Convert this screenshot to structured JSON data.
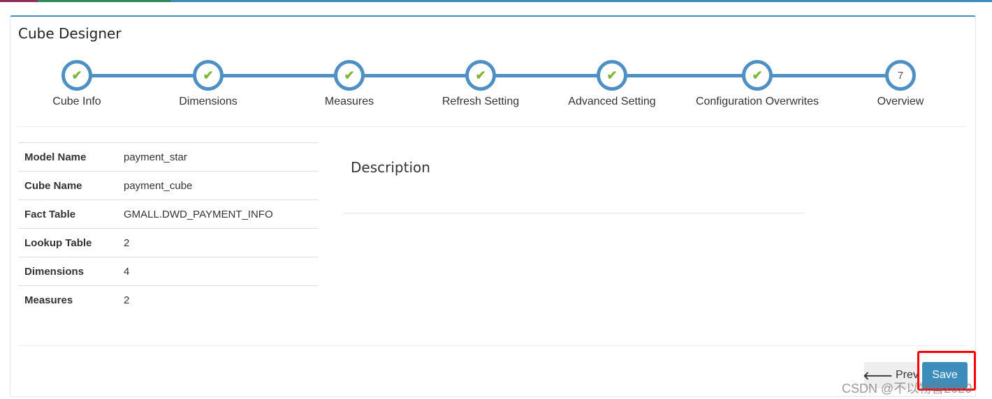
{
  "title": "Cube Designer",
  "steps": [
    {
      "label": "Cube Info",
      "state": "done"
    },
    {
      "label": "Dimensions",
      "state": "done"
    },
    {
      "label": "Measures",
      "state": "done"
    },
    {
      "label": "Refresh Setting",
      "state": "done"
    },
    {
      "label": "Advanced Setting",
      "state": "done"
    },
    {
      "label": "Configuration Overwrites",
      "state": "done"
    },
    {
      "label": "Overview",
      "state": "current",
      "number": "7"
    }
  ],
  "check_icon": "✔",
  "summary": [
    {
      "key": "Model Name",
      "value": "payment_star"
    },
    {
      "key": "Cube Name",
      "value": "payment_cube"
    },
    {
      "key": "Fact Table",
      "value": "GMALL.DWD_PAYMENT_INFO"
    },
    {
      "key": "Lookup Table",
      "value": "2"
    },
    {
      "key": "Dimensions",
      "value": "4"
    },
    {
      "key": "Measures",
      "value": "2"
    }
  ],
  "description_title": "Description",
  "buttons": {
    "prev": "Prev",
    "save": "Save"
  },
  "watermark": "CSDN @不以物喜2020",
  "colors": {
    "accent": "#3c8dbc",
    "step": "#4f90c4",
    "check": "#7cb82f",
    "highlight": "#ff0000"
  }
}
